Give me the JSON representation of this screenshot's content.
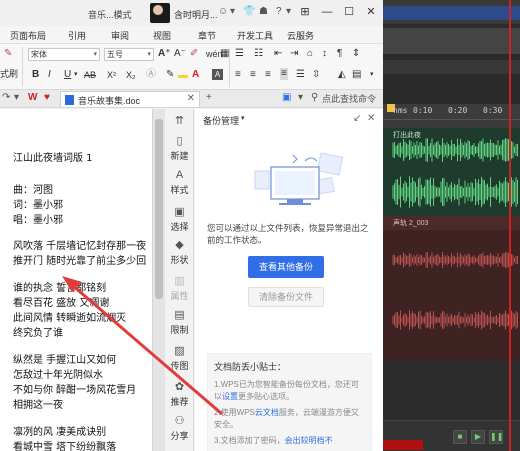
{
  "title_bar": {
    "app_label": "音乐...模式",
    "user_name": "含时明月...",
    "icons": [
      "smile-icon",
      "shirt-icon",
      "help-icon",
      "dropdown-icon"
    ],
    "window_controls": [
      "box-icon",
      "minimize",
      "maximize",
      "close"
    ]
  },
  "menu": {
    "items": [
      "页面布局",
      "引用",
      "审阅",
      "视图",
      "章节",
      "开发工具",
      "云服务"
    ]
  },
  "ribbon": {
    "left_partial": "式刷",
    "font_name": "宋体",
    "font_size": "五号",
    "bold": "B",
    "italic": "I",
    "underline": "U",
    "strike": "AB",
    "superscript": "X²",
    "subscript": "X₂",
    "grow_font": "A⁺",
    "shrink_font": "A⁻",
    "wen": "wén"
  },
  "tabs": {
    "doc_name": "音乐故事集.doc",
    "add": "+",
    "right_label": "点此查找命令"
  },
  "document": {
    "lines": [
      "江山此夜墙词版 1",
      "",
      "曲：河图",
      "词：墨小邪",
      "唱：墨小邪",
      "",
      "风吹落 千层墙记忆封存那一夜",
      "推开门 随时光靠了前尘多少回",
      "",
      "谁的执念 誓言都铭刻",
      "看尽百花 盛放 又凋谢",
      "此间风情 转瞬逝如流烟灭",
      "终究负了谁",
      "",
      "纵然是 手握江山又如何",
      "怎敌过十年光阴似水",
      "不如与你 醉酣一场风花雪月",
      "相拥这一夜",
      "",
      "凛冽的风 凄美成诀别",
      "看城中雪 塔下纷纷飘落"
    ]
  },
  "side_panel": {
    "items": [
      {
        "icon": "new-icon",
        "label": "新建"
      },
      {
        "icon": "style-icon",
        "label": "样式"
      },
      {
        "icon": "select-icon",
        "label": "选择"
      },
      {
        "icon": "shape-icon",
        "label": "形状"
      },
      {
        "icon": "property-icon",
        "label": "属性"
      },
      {
        "icon": "limit-icon",
        "label": "限制"
      },
      {
        "icon": "image-icon",
        "label": "传图"
      },
      {
        "icon": "recommend-icon",
        "label": "推荐"
      },
      {
        "icon": "share-icon",
        "label": "分享"
      }
    ]
  },
  "backup_panel": {
    "title": "备份管理",
    "description": "您可以通过以上文件列表，恢复异常退出之前的工作状态。",
    "primary_button": "查看其他备份",
    "secondary_button": "清除备份文件",
    "tips_title": "文档防丢小贴士：",
    "tips": [
      {
        "pre": "1.WPS已为您智能备份每份文档，您还可以",
        "link": "设置",
        "post": "更多贴心选项。"
      },
      {
        "pre": "2.使用WPS",
        "link": "云文档",
        "post": "服务，云端漫游方便又安全。"
      },
      {
        "pre": "3.文档添加了密码，",
        "link": "会出较明档不",
        "post": ""
      }
    ]
  },
  "audio_editor": {
    "ruler_labels": [
      "hms",
      "0:10",
      "0:20",
      "0:30"
    ],
    "track1_label": "打出此夜",
    "track2_label": "声轨 2_003",
    "colors": {
      "waveform_green": "#5fd17f",
      "waveform_red": "#b35050",
      "playhead": "#d02020"
    }
  },
  "annotation": {
    "arrow_color": "#e23b3b"
  }
}
